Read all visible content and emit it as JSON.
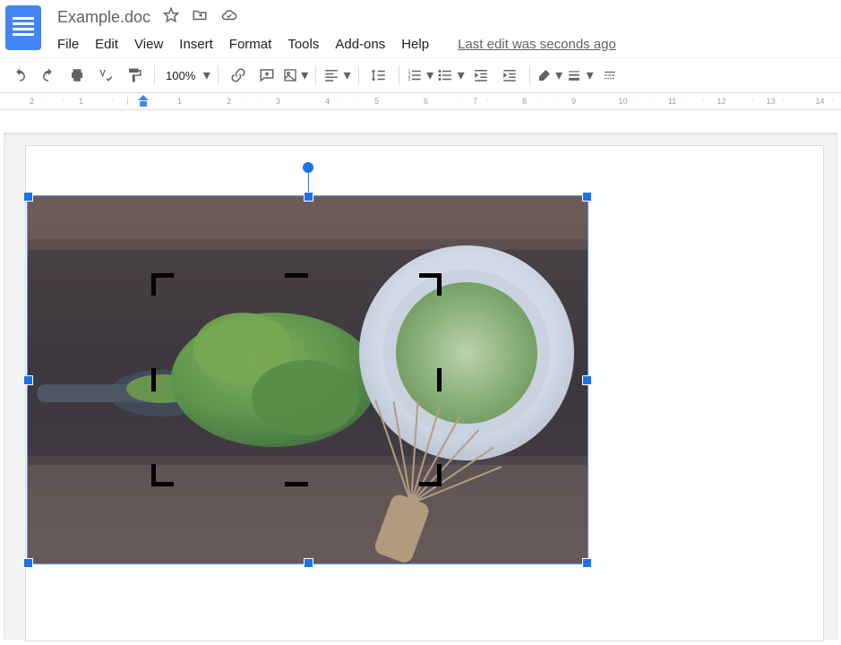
{
  "header": {
    "title": "Example.doc",
    "icons": {
      "star": "star-outline-icon",
      "move": "folder-move-icon",
      "cloud": "cloud-done-icon"
    },
    "last_edit": "Last edit was seconds ago"
  },
  "menu": {
    "file": "File",
    "edit": "Edit",
    "view": "View",
    "insert": "Insert",
    "format": "Format",
    "tools": "Tools",
    "addons": "Add-ons",
    "help": "Help"
  },
  "toolbar": {
    "zoom": "100%"
  },
  "ruler": {
    "marks": [
      "2",
      "1",
      "",
      "1",
      "2",
      "3",
      "4",
      "5",
      "6",
      "7",
      "8",
      "9",
      "10",
      "11",
      "12",
      "13",
      "14"
    ]
  },
  "canvas": {
    "image_description": "Top-down photo of matcha: wooden surface, pile of green matcha powder with a metal spoon, a white cup of frothy green matcha, and a bamboo whisk.",
    "image_selected": true,
    "crop_active": true
  }
}
